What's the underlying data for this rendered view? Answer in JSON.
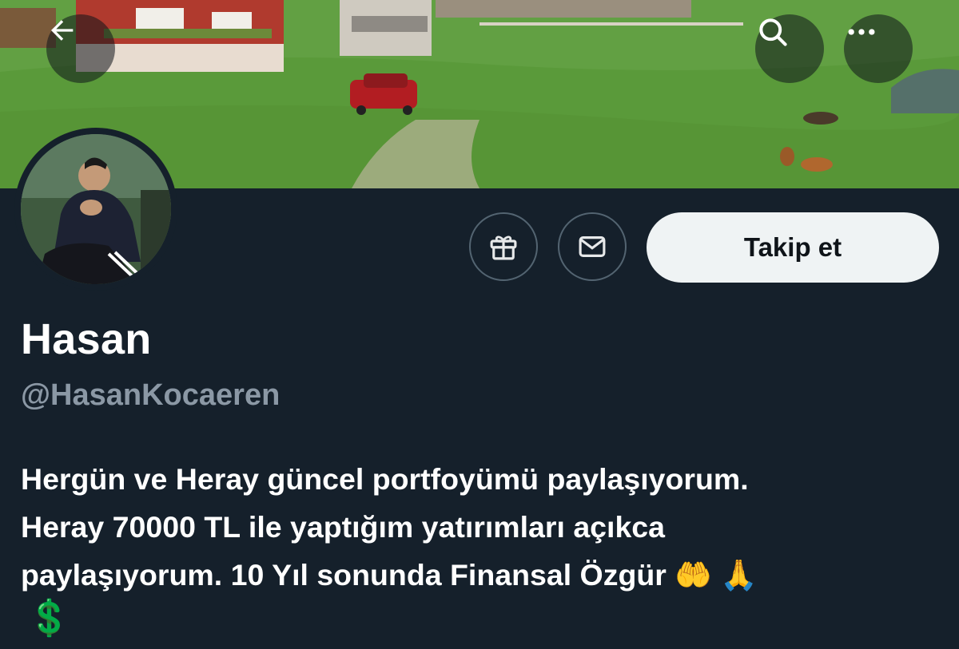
{
  "header": {
    "back_icon": "arrow-left-icon",
    "search_icon": "search-icon",
    "more_icon": "more-horizontal-icon"
  },
  "actions": {
    "gift_icon": "gift-icon",
    "message_icon": "mail-icon",
    "follow_label": "Takip et"
  },
  "profile": {
    "name": "Hasan",
    "handle": "@HasanKocaeren",
    "bio_lines": [
      "Hergün ve Heray güncel portfoyümü paylaşıyorum.",
      "Heray 70000 TL ile yaptığım yatırımları açıkca",
      "paylaşıyorum. 10 Yıl sonunda Finansal Özgür 🤲 🙏",
      "💲"
    ]
  },
  "colors": {
    "background": "#15202b",
    "follow_bg": "#eff3f4",
    "handle": "#8b98a5",
    "border": "#536471"
  }
}
